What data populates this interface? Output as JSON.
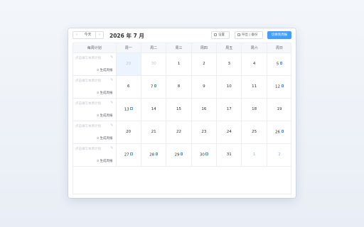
{
  "toolbar": {
    "prev_label": "‹",
    "today_label": "今天",
    "next_label": "›",
    "title": "2026 年 7 月",
    "settings_label": "设置",
    "export_label": "导出 | 备份",
    "primary_label": "切换到周报"
  },
  "grid": {
    "plan_header": "每周计划",
    "weekdays": [
      "周一",
      "周二",
      "周三",
      "周四",
      "周五",
      "周六",
      "周日"
    ],
    "weeks": [
      {
        "plan": "点击填写本周计划",
        "generate": "生成周报",
        "days": [
          {
            "n": "29",
            "kind": "past-other",
            "doc": false,
            "selected": true
          },
          {
            "n": "30",
            "kind": "past-other",
            "doc": false
          },
          {
            "n": "1",
            "kind": "cur",
            "doc": false
          },
          {
            "n": "2",
            "kind": "cur",
            "doc": false
          },
          {
            "n": "3",
            "kind": "cur",
            "doc": false
          },
          {
            "n": "4",
            "kind": "cur",
            "doc": false
          },
          {
            "n": "5",
            "kind": "cur",
            "doc": true
          }
        ]
      },
      {
        "plan": "点击填写本周计划",
        "generate": "生成周报",
        "days": [
          {
            "n": "6",
            "kind": "cur",
            "doc": false
          },
          {
            "n": "7",
            "kind": "cur",
            "doc": true
          },
          {
            "n": "8",
            "kind": "cur",
            "doc": false
          },
          {
            "n": "9",
            "kind": "cur",
            "doc": false
          },
          {
            "n": "10",
            "kind": "cur",
            "doc": false
          },
          {
            "n": "11",
            "kind": "cur",
            "doc": false
          },
          {
            "n": "12",
            "kind": "cur",
            "doc": true
          }
        ]
      },
      {
        "plan": "点击填写本周计划",
        "generate": "生成周报",
        "days": [
          {
            "n": "13",
            "kind": "cur",
            "doc": true
          },
          {
            "n": "14",
            "kind": "cur",
            "doc": false
          },
          {
            "n": "15",
            "kind": "cur",
            "doc": false
          },
          {
            "n": "16",
            "kind": "cur",
            "doc": false
          },
          {
            "n": "17",
            "kind": "cur",
            "doc": false
          },
          {
            "n": "18",
            "kind": "cur",
            "doc": false
          },
          {
            "n": "19",
            "kind": "cur",
            "doc": false
          }
        ]
      },
      {
        "plan": "点击填写本周计划",
        "generate": "生成周报",
        "days": [
          {
            "n": "20",
            "kind": "cur",
            "doc": false
          },
          {
            "n": "21",
            "kind": "cur",
            "doc": false
          },
          {
            "n": "22",
            "kind": "cur",
            "doc": false
          },
          {
            "n": "23",
            "kind": "cur",
            "doc": false
          },
          {
            "n": "24",
            "kind": "cur",
            "doc": false
          },
          {
            "n": "25",
            "kind": "cur",
            "doc": false
          },
          {
            "n": "26",
            "kind": "cur",
            "doc": true
          }
        ]
      },
      {
        "plan": "点击填写本周计划",
        "generate": "生成周报",
        "days": [
          {
            "n": "27",
            "kind": "cur",
            "doc": true
          },
          {
            "n": "28",
            "kind": "cur",
            "doc": true
          },
          {
            "n": "29",
            "kind": "cur",
            "doc": true
          },
          {
            "n": "30",
            "kind": "cur",
            "doc": true
          },
          {
            "n": "31",
            "kind": "cur",
            "doc": false
          },
          {
            "n": "1",
            "kind": "other",
            "doc": false
          },
          {
            "n": "2",
            "kind": "other",
            "doc": false
          }
        ]
      }
    ]
  },
  "colors": {
    "accent": "#409eff",
    "selected_bg": "#ecf5ff"
  }
}
